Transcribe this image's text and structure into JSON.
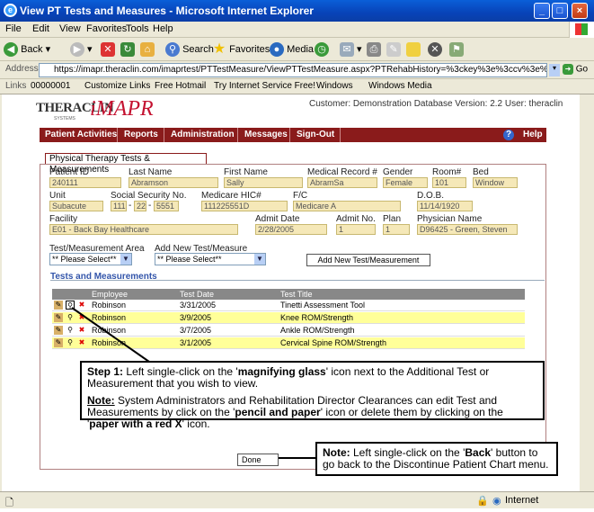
{
  "window": {
    "title": "View PT Tests and Measures - Microsoft Internet Explorer"
  },
  "menu": [
    "File",
    "Edit",
    "View",
    "Favorites",
    "Tools",
    "Help"
  ],
  "toolbar": {
    "back": "Back",
    "search": "Search",
    "favorites": "Favorites",
    "media": "Media"
  },
  "address": {
    "label": "Address",
    "url": "https://imapr.theraclin.com/imaprtest/PTTestMeasure/ViewPTTestMeasure.aspx?PTRehabHistory=%3ckey%3e%3ccv%3e%3cc%3ePTRehabHistoryID%",
    "go": "Go"
  },
  "links": {
    "label": "Links",
    "items": [
      "00000001",
      "Customize Links",
      "Free Hotmail",
      "Try Internet Service Free!",
      "Windows",
      "Windows Media"
    ]
  },
  "header": {
    "logo_thera": "THERACLIN",
    "logo_systems": "SYSTEMS",
    "logo_imapr": "iMAPR",
    "customer_line": "Customer: Demonstration Database Version: 2.2 User: theraclin"
  },
  "nav": [
    "Patient Activities",
    "Reports",
    "Administration",
    "Messages",
    "Sign-Out"
  ],
  "nav_help": "Help",
  "tab": "Physical Therapy Tests & Measurements",
  "patient": {
    "patient_id_label": "Patient ID",
    "patient_id": "240111",
    "last_name_label": "Last Name",
    "last_name": "Abramson",
    "first_name_label": "First Name",
    "first_name": "Sally",
    "mr_label": "Medical Record #",
    "mr": "AbramSa",
    "gender_label": "Gender",
    "gender": "Female",
    "room_label": "Room#",
    "room": "101",
    "bed_label": "Bed",
    "bed": "Window",
    "unit_label": "Unit",
    "unit": "Subacute",
    "ssn_label": "Social Security No.",
    "ssn1": "111",
    "ssn2": "22",
    "ssn3": "5551",
    "hic_label": "Medicare HIC#",
    "hic": "111225551D",
    "fc_label": "F/C",
    "fc": "Medicare A",
    "dob_label": "D.O.B.",
    "dob": "11/14/1920",
    "facility_label": "Facility",
    "facility": "E01 - Back Bay Healthcare",
    "admit_date_label": "Admit Date",
    "admit_date": "2/28/2005",
    "admit_no_label": "Admit No.",
    "admit_no": "1",
    "plan_label": "Plan",
    "plan": "1",
    "physician_label": "Physician Name",
    "physician": "D96425 - Green, Steven"
  },
  "filters": {
    "area_label": "Test/Measurement Area",
    "area_value": "** Please Select**",
    "add_label": "Add New Test/Measure",
    "add_value": "** Please Select**",
    "add_button": "Add New Test/Measurement"
  },
  "section_title": "Tests and Measurements",
  "table": {
    "headers": [
      "Employee",
      "Test Date",
      "Test Title"
    ],
    "rows": [
      {
        "employee": "Robinson",
        "date": "3/31/2005",
        "title": "Tinetti Assessment Tool"
      },
      {
        "employee": "Robinson",
        "date": "3/9/2005",
        "title": "Knee ROM/Strength"
      },
      {
        "employee": "Robinson",
        "date": "3/7/2005",
        "title": "Ankle ROM/Strength"
      },
      {
        "employee": "Robinson",
        "date": "3/1/2005",
        "title": "Cervical Spine ROM/Strength"
      }
    ]
  },
  "done_button": "Done",
  "callout1": {
    "step": "Step 1:",
    "p1a": " Left single-click on the '",
    "p1b": "magnifying glass",
    "p1c": "' icon next to the Additional Test or Measurement that you wish to view.",
    "note": "Note:",
    "p2a": " System Administrators and Rehabilitation Director Clearances can edit Test and Measurements by click on the '",
    "p2b": "pencil and paper",
    "p2c": "' icon or delete them by clicking on the '",
    "p2d": "paper with a red X",
    "p2e": "' icon."
  },
  "callout2": {
    "note": "Note:",
    "p1": " Left single-click on the '",
    "bold": "Back",
    "p2": "' button to go back to the Discontinue Patient Chart menu."
  },
  "status": {
    "zone": "Internet"
  }
}
